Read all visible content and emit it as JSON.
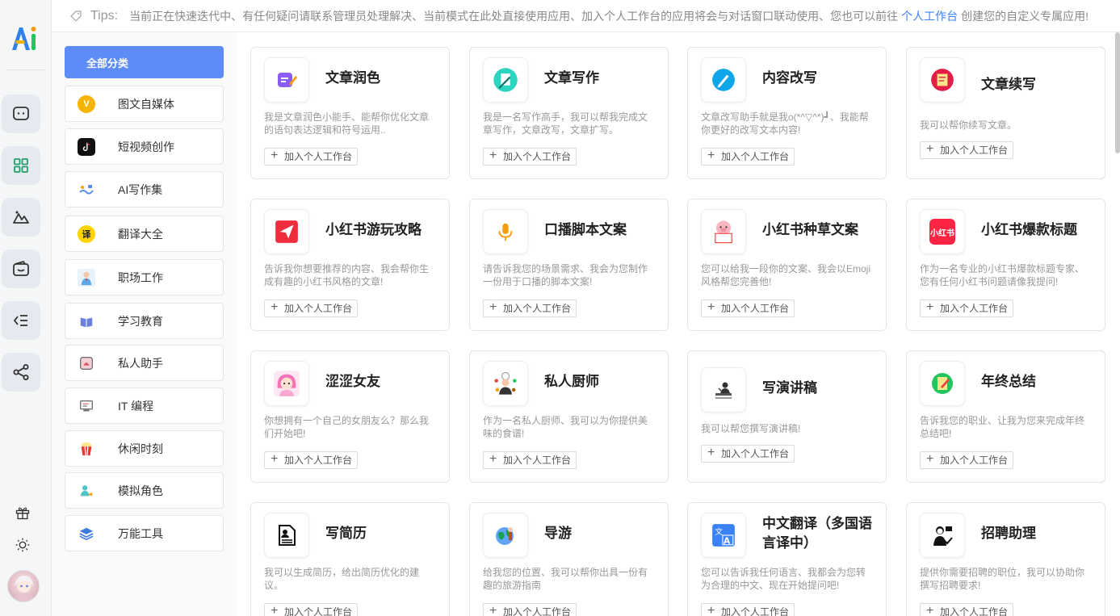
{
  "tips": {
    "label": "Tips:",
    "text_before": "当前正在快速迭代中、有任何疑问请联系管理员处理解决、当前模式在此处直接使用应用、加入个人工作台的应用将会与对话窗口联动使用、您也可以前往",
    "link": "个人工作台",
    "text_after": "创建您的自定义专属应用!"
  },
  "categories": [
    {
      "label": "全部分类"
    },
    {
      "label": "图文自媒体",
      "icon": "v-badge-icon",
      "color": "#f5b400"
    },
    {
      "label": "短视频创作",
      "icon": "tiktok-icon",
      "color": "#111111"
    },
    {
      "label": "AI写作集",
      "icon": "writing-robot-icon",
      "color": "#5b8def"
    },
    {
      "label": "翻译大全",
      "icon": "translate-icon",
      "glyph": "译",
      "color": "#ffd400"
    },
    {
      "label": "职场工作",
      "icon": "office-worker-icon",
      "color": "#5aa8e6"
    },
    {
      "label": "学习教育",
      "icon": "book-icon",
      "color": "#6a7fd8"
    },
    {
      "label": "私人助手",
      "icon": "assistant-icon",
      "color": "#e05a6a"
    },
    {
      "label": "IT 编程",
      "icon": "computer-icon",
      "color": "#8a8a8a"
    },
    {
      "label": "休闲时刻",
      "icon": "popcorn-icon",
      "color": "#e53935"
    },
    {
      "label": "模拟角色",
      "icon": "role-icon",
      "color": "#4fc3c7"
    },
    {
      "label": "万能工具",
      "icon": "layers-icon",
      "color": "#3f7be0"
    }
  ],
  "add_label": "加入个人工作台",
  "cards": [
    {
      "title": "文章润色",
      "desc": "我是文章润色小能手、能帮你优化文章的语句表达逻辑和符号运用..",
      "icon": "polish-icon",
      "color": "#8b5cf6"
    },
    {
      "title": "文章写作",
      "desc": "我是一名写作高手，我可以帮我完成文章写作，文章改写，文章扩写。",
      "icon": "writing-icon",
      "color": "#2dd4bf"
    },
    {
      "title": "内容改写",
      "desc": "文章改写助手就是我o(*^▽^*)┛、我能帮你更好的改写文本内容!",
      "icon": "pen-icon",
      "color": "#0ea5e9"
    },
    {
      "title": "文章续写",
      "desc": "我可以帮你续写文章。",
      "icon": "continue-icon",
      "color": "#e11d48"
    },
    {
      "title": "小红书游玩攻略",
      "desc": "告诉我你想要推荐的内容、我会帮你生成有趣的小红书风格的文章!",
      "icon": "paper-plane-icon",
      "color": "#ef2d3d"
    },
    {
      "title": "口播脚本文案",
      "desc": "请告诉我您的场景需求、我会为您制作一份用于口播的脚本文案!",
      "icon": "microphone-icon",
      "color": "#f59e0b"
    },
    {
      "title": "小红书种草文案",
      "desc": "您可以给我一段你的文案、我会以Emoji风格帮您完善他!",
      "icon": "pig-icon",
      "color": "#f28b9a"
    },
    {
      "title": "小红书爆款标题",
      "desc": "作为一名专业的小红书爆款标题专家、您有任何小红书问题请像我提问!",
      "icon": "xiaohongshu-icon",
      "color": "#ff2442",
      "glyph": "小红书"
    },
    {
      "title": "涩涩女友",
      "desc": "你想拥有一个自己的女朋友么？那么我们开始吧!",
      "icon": "girlfriend-icon",
      "color": "#f472b6"
    },
    {
      "title": "私人厨师",
      "desc": "作为一名私人厨师、我可以为你提供美味的食谱!",
      "icon": "chef-icon",
      "color": "#a16207"
    },
    {
      "title": "写演讲稿",
      "desc": "我可以帮您撰写演讲稿!",
      "icon": "speech-icon",
      "color": "#333333"
    },
    {
      "title": "年终总结",
      "desc": "告诉我您的职业、让我为您来完成年终总结吧!",
      "icon": "summary-icon",
      "color": "#22c55e"
    },
    {
      "title": "写简历",
      "desc": "我可以生成简历，给出简历优化的建议。",
      "icon": "resume-icon",
      "color": "#111111"
    },
    {
      "title": "导游",
      "desc": "给我您的位置、我可以帮你出具一份有趣的旅游指南",
      "icon": "tour-guide-icon",
      "color": "#16a34a"
    },
    {
      "title": "中文翻译（多国语言译中）",
      "desc": "您可以告诉我任何语言、我都会为您转为合理的中文、现在开始提问吧!",
      "icon": "translate-card-icon",
      "color": "#3b82f6"
    },
    {
      "title": "招聘助理",
      "desc": "提供你需要招聘的职位，我可以协助你撰写招聘要求!",
      "icon": "recruit-icon",
      "color": "#111111"
    }
  ]
}
